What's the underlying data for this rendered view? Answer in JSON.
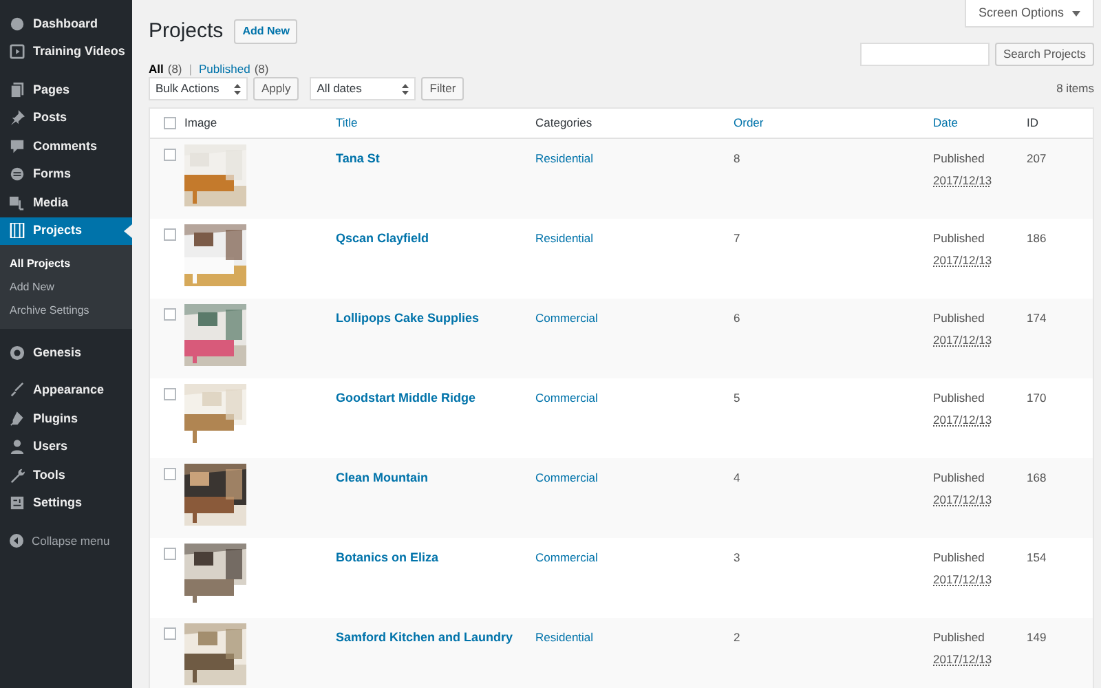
{
  "sidebar": {
    "groups": [
      [
        {
          "label": "Dashboard",
          "selected": false
        },
        {
          "label": "Training Videos",
          "selected": false
        }
      ],
      [
        {
          "label": "Pages",
          "selected": false
        },
        {
          "label": "Posts",
          "selected": false
        },
        {
          "label": "Comments",
          "selected": false
        },
        {
          "label": "Forms",
          "selected": false
        },
        {
          "label": "Media",
          "selected": false
        },
        {
          "label": "Projects",
          "selected": true,
          "submenu": [
            {
              "label": "All Projects",
              "selected": true
            },
            {
              "label": "Add New",
              "selected": false
            },
            {
              "label": "Archive Settings",
              "selected": false
            }
          ]
        }
      ],
      [
        {
          "label": "Genesis",
          "selected": false
        }
      ],
      [
        {
          "label": "Appearance",
          "selected": false
        },
        {
          "label": "Plugins",
          "selected": false
        },
        {
          "label": "Users",
          "selected": false
        },
        {
          "label": "Tools",
          "selected": false
        },
        {
          "label": "Settings",
          "selected": false
        }
      ]
    ],
    "collapse": "Collapse menu"
  },
  "screen_options": "Screen Options",
  "heading": "Projects",
  "add_new": "Add New",
  "views": [
    {
      "label": "All",
      "count": "(8)",
      "selected": true
    },
    {
      "label": "Published",
      "count": "(8)",
      "selected": false
    }
  ],
  "view_separator": "|",
  "search": {
    "button": "Search Projects"
  },
  "bulk_actions": "Bulk Actions",
  "apply": "Apply",
  "dates": "All dates",
  "filter": "Filter",
  "items_count": "8 items",
  "table": {
    "select_all_checked": false,
    "columns": [
      {
        "label": "Image",
        "sortable": false
      },
      {
        "label": "Title",
        "sortable": true
      },
      {
        "label": "Categories",
        "sortable": false
      },
      {
        "label": "Order",
        "sortable": true
      },
      {
        "label": "Date",
        "sortable": true
      },
      {
        "label": "ID",
        "sortable": false
      }
    ],
    "rows": [
      {
        "title": "Tana St",
        "category": "Residential",
        "order": "8",
        "status": "Published",
        "date": "2017/12/13",
        "id": "207",
        "checked": false
      },
      {
        "title": "Qscan Clayfield",
        "category": "Residential",
        "order": "7",
        "status": "Published",
        "date": "2017/12/13",
        "id": "186",
        "checked": false
      },
      {
        "title": "Lollipops Cake Supplies",
        "category": "Commercial",
        "order": "6",
        "status": "Published",
        "date": "2017/12/13",
        "id": "174",
        "checked": false
      },
      {
        "title": "Goodstart Middle Ridge",
        "category": "Commercial",
        "order": "5",
        "status": "Published",
        "date": "2017/12/13",
        "id": "170",
        "checked": false
      },
      {
        "title": "Clean Mountain",
        "category": "Commercial",
        "order": "4",
        "status": "Published",
        "date": "2017/12/13",
        "id": "168",
        "checked": false
      },
      {
        "title": "Botanics on Eliza",
        "category": "Commercial",
        "order": "3",
        "status": "Published",
        "date": "2017/12/13",
        "id": "154",
        "checked": false
      },
      {
        "title": "Samford Kitchen and Laundry",
        "category": "Residential",
        "order": "2",
        "status": "Published",
        "date": "2017/12/13",
        "id": "149",
        "checked": false
      }
    ]
  }
}
